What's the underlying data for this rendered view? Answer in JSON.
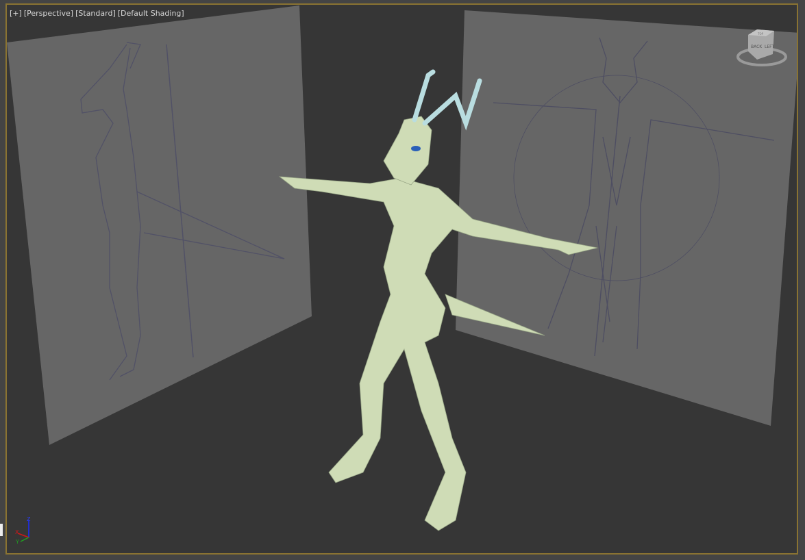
{
  "viewport": {
    "labels": [
      "[+]",
      "[Perspective]",
      "[Standard]",
      "[Default Shading]"
    ],
    "border_color": "#8a7332",
    "background": "#363636"
  },
  "viewcube": {
    "faces": [
      "BACK",
      "LEFT",
      "TOP"
    ]
  },
  "axis_gizmo": {
    "x": "X",
    "y": "Y",
    "z": "Z"
  },
  "model": {
    "color": "#cfdcb6",
    "horn_color": "#b9dde0",
    "eye_color": "#2a5fb8"
  }
}
